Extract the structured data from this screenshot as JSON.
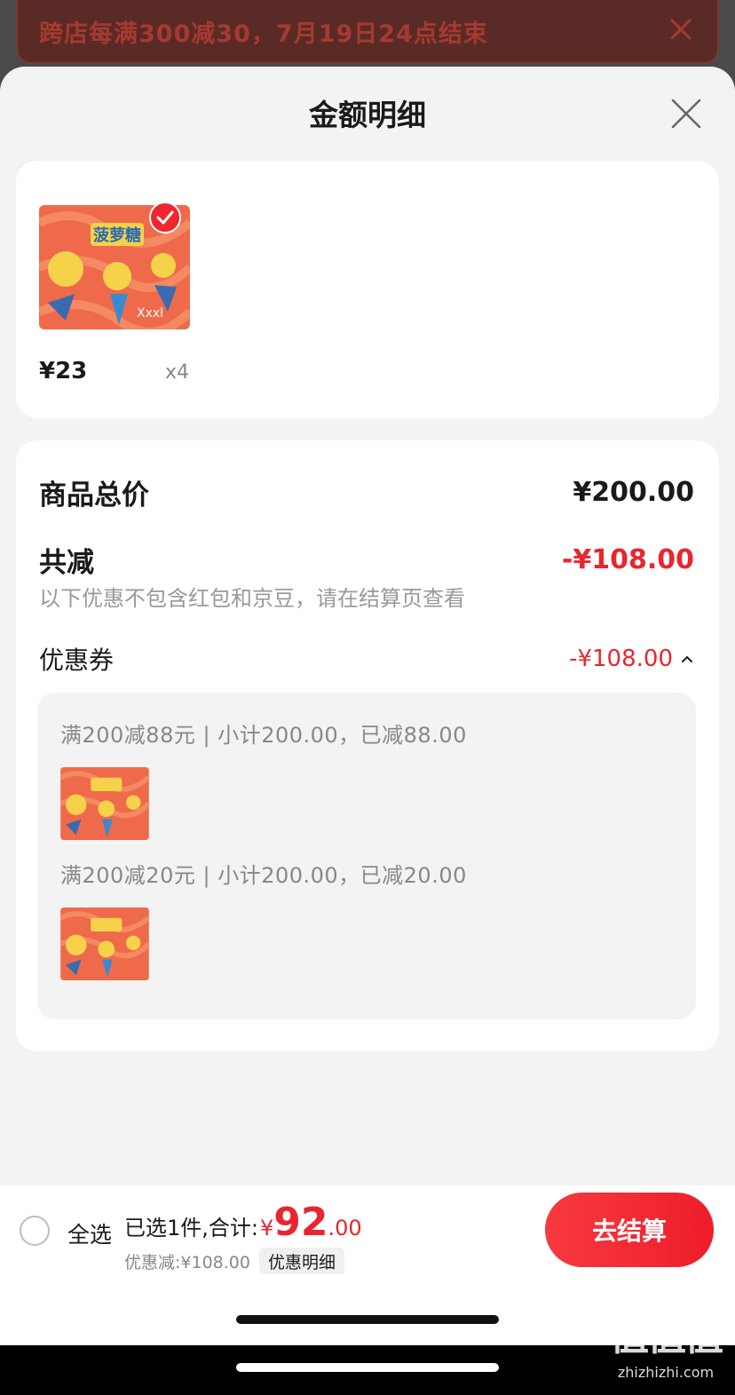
{
  "banner": {
    "text": "跨店每满300减30，7月19日24点结束"
  },
  "sheet": {
    "title": "金额明细"
  },
  "product": {
    "price": "¥23",
    "qty": "x4",
    "image_brand": "菠萝糖",
    "image_size": "Xxxl"
  },
  "detail": {
    "total_label": "商品总价",
    "total_value": "¥200.00",
    "reduce_label": "共减",
    "reduce_value": "-¥108.00",
    "note": "以下优惠不包含红包和京豆，请在结算页查看",
    "coupon_label": "优惠券",
    "coupon_value": "-¥108.00",
    "coupons": [
      {
        "line": "满200减88元 | 小计200.00，已减88.00"
      },
      {
        "line": "满200减20元 | 小计200.00，已减20.00"
      }
    ]
  },
  "bottom": {
    "select_all": "全选",
    "summary_label": "已选1件,合计:",
    "currency": "¥",
    "total_int": "92",
    "total_dec": ".00",
    "discount": "优惠减:¥108.00",
    "detail_link": "优惠明细",
    "checkout": "去结算"
  },
  "watermark": {
    "glyphs": "值值值",
    "url": "zhizhizhi.com"
  },
  "colors": {
    "accent": "#e8262e",
    "sheet_bg": "#f3f3f3",
    "overlay": "#4a4a4a"
  }
}
